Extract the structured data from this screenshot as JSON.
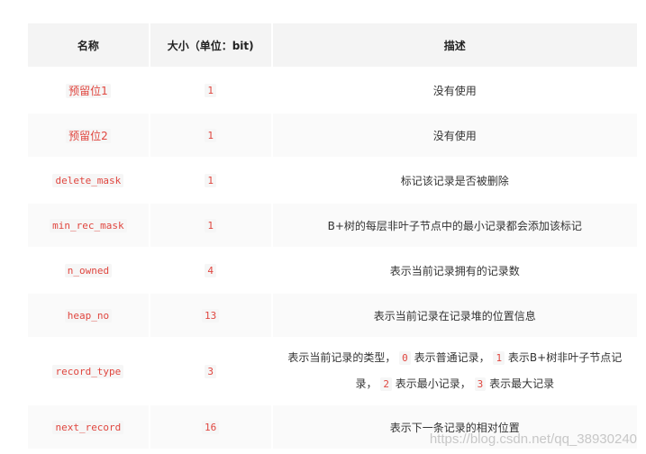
{
  "table": {
    "headers": [
      "名称",
      "大小（单位：bit)",
      "描述"
    ],
    "rows": [
      {
        "name": "预留位1",
        "size": "1",
        "desc_parts": [
          "没有使用"
        ]
      },
      {
        "name": "预留位2",
        "size": "1",
        "desc_parts": [
          "没有使用"
        ]
      },
      {
        "name": "delete_mask",
        "size": "1",
        "desc_parts": [
          "标记该记录是否被删除"
        ]
      },
      {
        "name": "min_rec_mask",
        "size": "1",
        "desc_parts": [
          "B+树的每层非叶子节点中的最小记录都会添加该标记"
        ]
      },
      {
        "name": "n_owned",
        "size": "4",
        "desc_parts": [
          "表示当前记录拥有的记录数"
        ]
      },
      {
        "name": "heap_no",
        "size": "13",
        "desc_parts": [
          "表示当前记录在记录堆的位置信息"
        ]
      },
      {
        "name": "record_type",
        "size": "3",
        "desc_line1_a": "表示当前记录的类型，",
        "desc_code_0": "0",
        "desc_line1_b": "表示普通记录，",
        "desc_code_1": "1",
        "desc_line1_c": "表示B+树非叶子节点记",
        "desc_line2_a": "录，",
        "desc_code_2": "2",
        "desc_line2_b": "表示最小记录，",
        "desc_code_3": "3",
        "desc_line2_c": "表示最大记录"
      },
      {
        "name": "next_record",
        "size": "16",
        "desc_parts": [
          "表示下一条记录的相对位置"
        ]
      }
    ]
  },
  "watermark": "https://blog.csdn.net/qq_38930240"
}
